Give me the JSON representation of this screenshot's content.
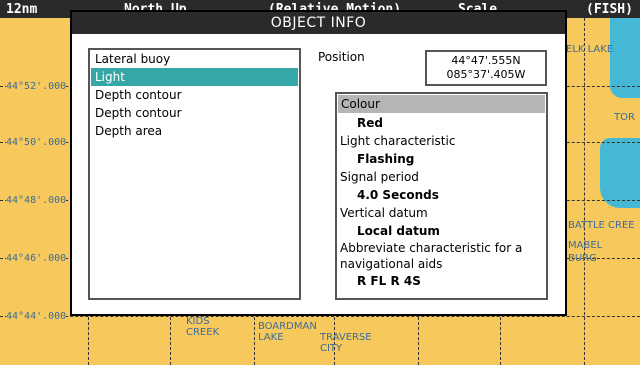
{
  "status_bar": {
    "range": "12nm",
    "north_up": "North Up",
    "motion": "(Relative Motion)",
    "scale": "Scale",
    "mode": "(FISH)"
  },
  "map": {
    "latitudes": [
      "44°52'.000",
      "44°50'.000",
      "44°48'.000",
      "44°46'.000",
      "44°44'.000"
    ],
    "places": [
      {
        "name": "ELK LAKE"
      },
      {
        "name": "TOR"
      },
      {
        "name": "BATTLE CREE"
      },
      {
        "name": "MABEL"
      },
      {
        "name": "BURG"
      },
      {
        "name": "KIDS\nCREEK"
      },
      {
        "name": "BOARDMAN\nLAKE"
      },
      {
        "name": "TRAVERSE\nCITY"
      }
    ]
  },
  "dialog": {
    "title": "OBJECT INFO",
    "objects": [
      {
        "label": "Lateral buoy",
        "selected": false
      },
      {
        "label": "Light",
        "selected": true
      },
      {
        "label": "Depth contour",
        "selected": false
      },
      {
        "label": "Depth contour",
        "selected": false
      },
      {
        "label": "Depth area",
        "selected": false
      }
    ],
    "position_label": "Position",
    "lat": "44°47'.555N",
    "lon": "085°37'.405W",
    "attributes": [
      {
        "name": "Colour",
        "value": "Red"
      },
      {
        "name": "Light characteristic",
        "value": "Flashing"
      },
      {
        "name": "Signal period",
        "value": "4.0 Seconds"
      },
      {
        "name": "Vertical datum",
        "value": "Local datum"
      },
      {
        "name": "Abbreviate characteristic for a navigational aids",
        "value": "R FL R 4S"
      }
    ]
  },
  "colors": {
    "land": "#f7c95c",
    "water": "#45b8d6",
    "title_bar": "#2a2a2a",
    "selection": "#35a7a6",
    "highlight": "#b5b5b5"
  }
}
